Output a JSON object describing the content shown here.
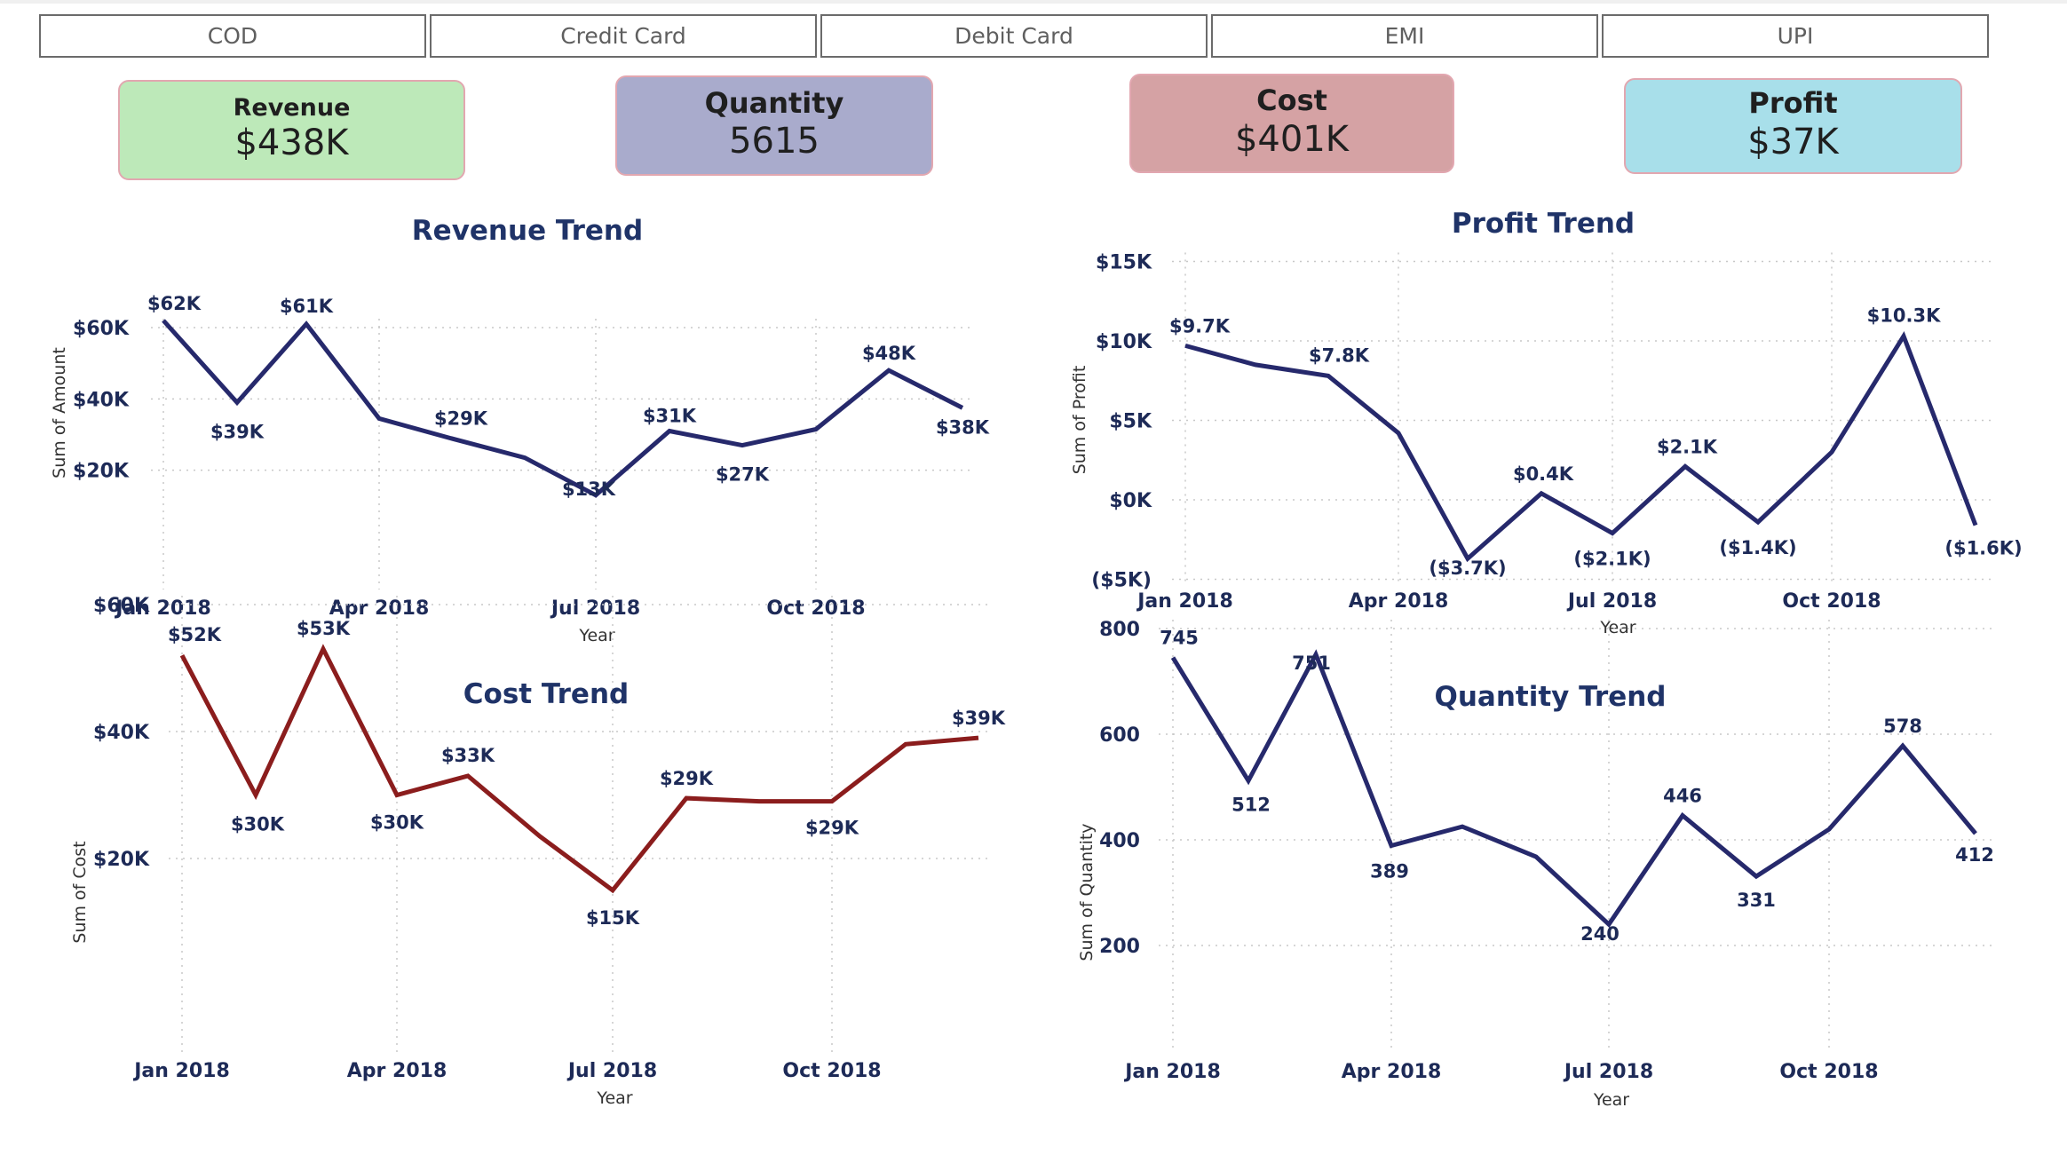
{
  "slicer": {
    "options": [
      "COD",
      "Credit Card",
      "Debit Card",
      "EMI",
      "UPI"
    ]
  },
  "kpis": {
    "revenue": {
      "title": "Revenue",
      "value": "$438K",
      "color": "#bde9b9"
    },
    "quantity": {
      "title": "Quantity",
      "value": "5615",
      "color": "#a9abcc"
    },
    "cost": {
      "title": "Cost",
      "value": "$401K",
      "color": "#d5a2a4"
    },
    "profit": {
      "title": "Profit",
      "value": "$37K",
      "color": "#a8dfea"
    }
  },
  "colors": {
    "navy_line": "#26296c",
    "cost_line": "#8b1d1d",
    "text_navy": "#1d2a57"
  },
  "chart_data": [
    {
      "id": "revenue",
      "type": "line",
      "title": "Revenue Trend",
      "xlabel": "Year",
      "ylabel": "Sum of Amount",
      "x": [
        "2018-01",
        "2018-02",
        "2018-03",
        "2018-04",
        "2018-05",
        "2018-06",
        "2018-07",
        "2018-08",
        "2018-09",
        "2018-10",
        "2018-11",
        "2018-12"
      ],
      "x_ticks": [
        "Jan 2018",
        "Apr 2018",
        "Jul 2018",
        "Oct 2018"
      ],
      "y_ticks": [
        "$20K",
        "$40K",
        "$60K"
      ],
      "ylim": [
        0,
        65000
      ],
      "series": [
        {
          "values": [
            62000,
            39000,
            61000,
            34500,
            29000,
            23500,
            13000,
            31000,
            27000,
            31500,
            48000,
            37500
          ]
        }
      ],
      "data_labels": [
        "$62K",
        "$39K",
        "$61K",
        "",
        "$29K",
        "",
        "$13K",
        "$31K",
        "$27K",
        "",
        "$48K",
        "$38K"
      ],
      "line_color": "#26296c",
      "grid": true
    },
    {
      "id": "profit",
      "type": "line",
      "title": "Profit Trend",
      "xlabel": "Year",
      "ylabel": "Sum of Profit",
      "x": [
        "2018-01",
        "2018-02",
        "2018-03",
        "2018-04",
        "2018-05",
        "2018-06",
        "2018-07",
        "2018-08",
        "2018-09",
        "2018-10",
        "2018-11",
        "2018-12"
      ],
      "x_ticks": [
        "Jan 2018",
        "Apr 2018",
        "Jul 2018",
        "Oct 2018"
      ],
      "y_ticks": [
        "($5K)",
        "$0K",
        "$5K",
        "$10K",
        "$15K"
      ],
      "ylim": [
        -5000,
        15000
      ],
      "series": [
        {
          "values": [
            9700,
            8500,
            7800,
            4200,
            -3700,
            400,
            -2100,
            2100,
            -1400,
            3000,
            10300,
            -1600
          ]
        }
      ],
      "data_labels": [
        "$9.7K",
        "",
        "$7.8K",
        "",
        "($3.7K)",
        "$0.4K",
        "($2.1K)",
        "$2.1K",
        "($1.4K)",
        "",
        "$10.3K",
        "($1.6K)"
      ],
      "line_color": "#26296c",
      "grid": true
    },
    {
      "id": "cost",
      "type": "line",
      "title": "Cost Trend",
      "xlabel": "Year",
      "ylabel": "Sum of Cost",
      "x": [
        "2018-01",
        "2018-02",
        "2018-03",
        "2018-04",
        "2018-05",
        "2018-06",
        "2018-07",
        "2018-08",
        "2018-09",
        "2018-10",
        "2018-11",
        "2018-12"
      ],
      "x_ticks": [
        "Jan 2018",
        "Apr 2018",
        "Jul 2018",
        "Oct 2018"
      ],
      "y_ticks": [
        "$20K",
        "$40K",
        "$60K"
      ],
      "ylim": [
        10000,
        60000
      ],
      "series": [
        {
          "values": [
            52000,
            30000,
            53000,
            30000,
            33000,
            23500,
            15000,
            29500,
            29000,
            29000,
            38000,
            39000
          ]
        }
      ],
      "data_labels": [
        "$52K",
        "$30K",
        "$53K",
        "$30K",
        "$33K",
        "",
        "$15K",
        "$29K",
        "",
        "$29K",
        "",
        "$39K"
      ],
      "line_color": "#8b1d1d",
      "grid": true
    },
    {
      "id": "quantity",
      "type": "line",
      "title": "Quantity Trend",
      "xlabel": "Year",
      "ylabel": "Sum of Quantity",
      "x": [
        "2018-01",
        "2018-02",
        "2018-03",
        "2018-04",
        "2018-05",
        "2018-06",
        "2018-07",
        "2018-08",
        "2018-09",
        "2018-10",
        "2018-11",
        "2018-12"
      ],
      "x_ticks": [
        "Jan 2018",
        "Apr 2018",
        "Jul 2018",
        "Oct 2018"
      ],
      "y_ticks": [
        "200",
        "400",
        "600",
        "800"
      ],
      "ylim": [
        200,
        800
      ],
      "series": [
        {
          "values": [
            745,
            512,
            751,
            389,
            425,
            368,
            240,
            446,
            331,
            420,
            578,
            412
          ]
        }
      ],
      "data_labels": [
        "745",
        "512",
        "751",
        "389",
        "",
        "",
        "240",
        "446",
        "331",
        "",
        "578",
        "412"
      ],
      "line_color": "#26296c",
      "grid": true
    }
  ]
}
